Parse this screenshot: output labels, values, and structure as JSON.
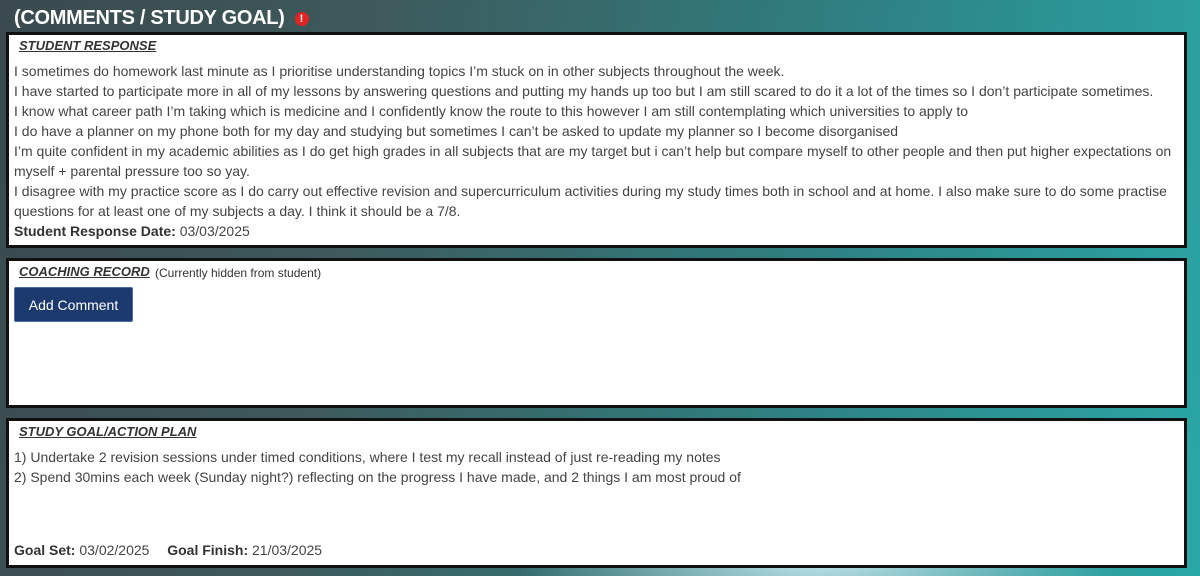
{
  "header": {
    "title": "(COMMENTS / STUDY GOAL)",
    "info_icon": "info-icon"
  },
  "student_response": {
    "heading": "STUDENT RESPONSE",
    "lines": [
      "I sometimes do homework last minute as I prioritise understanding topics I’m stuck on in other subjects throughout the week.",
      "I have started to participate more in all of my lessons by answering questions and putting my hands up too but I am still scared to do it a lot of the times so I don’t participate sometimes.",
      "I know what career path I’m taking which is medicine and I confidently know the route to this however I am still contemplating which universities to apply to",
      "I do have a planner on my phone both for my day and studying but sometimes I can’t be asked to update my planner so I become disorganised",
      "I’m quite confident in my academic abilities as I do get high grades in all subjects that are my target but i can’t help but compare myself to other people and then put higher expectations on myself + parental pressure too so yay.",
      "I disagree with my practice score as I do carry out effective revision and supercurriculum activities during my study times both in school and at home. I also make sure to do some practise questions for at least one of my subjects a day. I think it should be a 7/8."
    ],
    "date_label": "Student Response Date:",
    "date_value": "03/03/2025"
  },
  "coaching_record": {
    "heading": "COACHING RECORD",
    "note": "(Currently hidden from student)",
    "add_button_label": "Add Comment"
  },
  "study_goal": {
    "heading": "STUDY GOAL/ACTION PLAN",
    "items": [
      "1) Undertake 2 revision sessions under timed conditions, where I test my recall instead of just re-reading my notes",
      "2) Spend 30mins each week (Sunday night?) reflecting on the progress I have made, and 2 things I am most proud of"
    ],
    "goal_set_label": "Goal Set:",
    "goal_set_value": "03/02/2025",
    "goal_finish_label": "Goal Finish:",
    "goal_finish_value": "21/03/2025"
  },
  "colors": {
    "accent_button": "#1d3a6e",
    "info_icon": "#e02424",
    "panel_border": "#111111"
  }
}
